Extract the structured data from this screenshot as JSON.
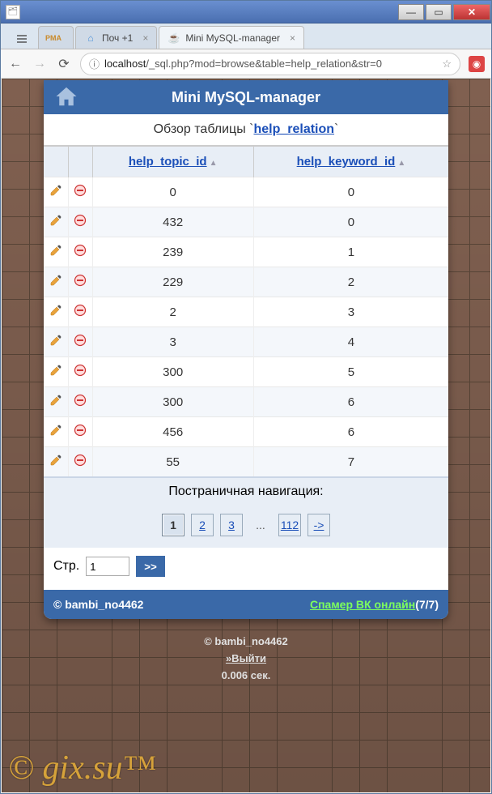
{
  "window": {
    "tabs": [
      {
        "icon": "pma",
        "label": ""
      },
      {
        "icon": "home",
        "label": "Поч +1"
      },
      {
        "icon": "cup",
        "label": "Mini MySQL-manager"
      }
    ],
    "url_host": "localhost",
    "url_path": "/_sql.php?mod=browse&table=help_relation&str=0"
  },
  "app": {
    "title": "Mini MySQL-manager",
    "overview_prefix": "Обзор таблицы `",
    "overview_table": "help_relation",
    "overview_suffix": "`",
    "columns": [
      "help_topic_id",
      "help_keyword_id"
    ],
    "rows": [
      {
        "topic": "0",
        "keyword": "0"
      },
      {
        "topic": "432",
        "keyword": "0"
      },
      {
        "topic": "239",
        "keyword": "1"
      },
      {
        "topic": "229",
        "keyword": "2"
      },
      {
        "topic": "2",
        "keyword": "3"
      },
      {
        "topic": "3",
        "keyword": "4"
      },
      {
        "topic": "300",
        "keyword": "5"
      },
      {
        "topic": "300",
        "keyword": "6"
      },
      {
        "topic": "456",
        "keyword": "6"
      },
      {
        "topic": "55",
        "keyword": "7"
      }
    ],
    "pagination": {
      "title": "Постраничная навигация:",
      "pages": [
        "1",
        "2",
        "3",
        "...",
        "112",
        "->"
      ],
      "current": "1",
      "page_label": "Стр.",
      "page_value": "1",
      "go_label": ">>"
    },
    "footer": {
      "copyright": "© bambi_no4462",
      "spam_text": "Спамер ВК онлайн",
      "spam_count": "(7/7)"
    }
  },
  "page_footer": {
    "copyright": "© bambi_no4462",
    "logout": "»Выйти",
    "timing": "0.006 сек."
  },
  "watermark": "© gix.su™"
}
